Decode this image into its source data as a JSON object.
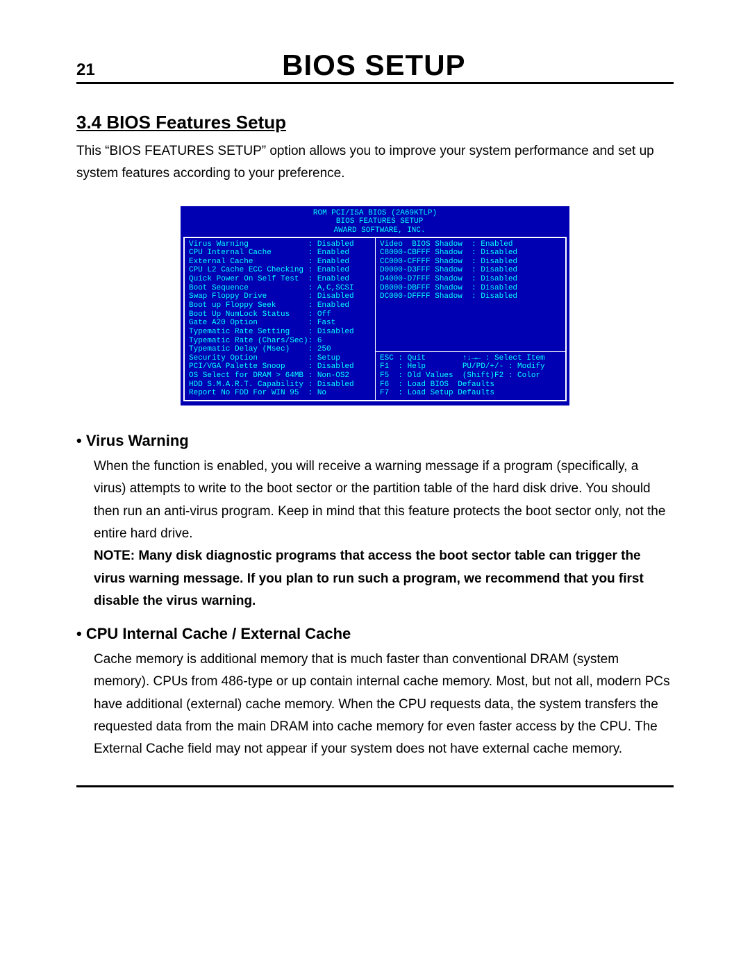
{
  "page_number": "21",
  "page_title": "BIOS SETUP",
  "section_heading": "3.4 BIOS Features Setup",
  "intro": "This “BIOS FEATURES SETUP” option allows you to improve your system performance and set up system features according to your preference.",
  "bios": {
    "header": "ROM PCI/ISA BIOS (2A69KTLP)\n  BIOS FEATURES SETUP\n  AWARD SOFTWARE, INC.",
    "left": "Virus Warning             : Disabled\nCPU Internal Cache        : Enabled\nExternal Cache            : Enabled\nCPU L2 Cache ECC Checking : Enabled\nQuick Power On Self Test  : Enabled\nBoot Sequence             : A,C,SCSI\nSwap Floppy Drive         : Disabled\nBoot up Floppy Seek       : Enabled\nBoot Up NumLock Status    : Off\nGate A20 Option           : Fast\nTypematic Rate Setting    : Disabled\nTypematic Rate (Chars/Sec): 6\nTypematic Delay (Msec)    : 250\nSecurity Option           : Setup\nPCI/VGA Palette Snoop     : Disabled\nOS Select for DRAM > 64MB : Non-OS2\nHDD S.M.A.R.T. Capability : Disabled\nReport No FDD For WIN 95  : No",
    "right_top": "Video  BIOS Shadow  : Enabled\nC8000-CBFFF Shadow  : Disabled\nCC000-CFFFF Shadow  : Disabled\nD0000-D3FFF Shadow  : Disabled\nD4000-D7FFF Shadow  : Disabled\nD8000-DBFFF Shadow  : Disabled\nDC000-DFFFF Shadow  : Disabled",
    "right_bottom": "ESC : Quit        ↑↓→← : Select Item\nF1  : Help        PU/PD/+/- : Modify\nF5  : Old Values  (Shift)F2 : Color\nF6  : Load BIOS  Defaults\nF7  : Load Setup Defaults"
  },
  "items": [
    {
      "heading": "• Virus Warning",
      "paragraphs": [
        "When the function is enabled, you will receive a warning message if a program (specifically, a virus) attempts to write to the boot sector or the partition table of the hard disk drive. You should then run an anti-virus program. Keep in mind that this feature protects the boot sector only, not the entire hard drive."
      ],
      "note": "NOTE: Many disk diagnostic programs that access the boot sector table can trigger the virus warning message. If you plan to run such a program, we recommend that you first disable the virus warning."
    },
    {
      "heading": "• CPU Internal Cache / External Cache",
      "paragraphs": [
        "Cache memory is additional memory that is much faster than conventional DRAM (system memory). CPUs from 486-type or up contain internal cache memory. Most, but not all, modern PCs have additional (external) cache memory. When the CPU requests data, the system transfers the requested data from the main DRAM into cache memory for even faster access by the CPU. The External Cache field may not appear if your system does not have external cache memory."
      ],
      "note": ""
    }
  ]
}
